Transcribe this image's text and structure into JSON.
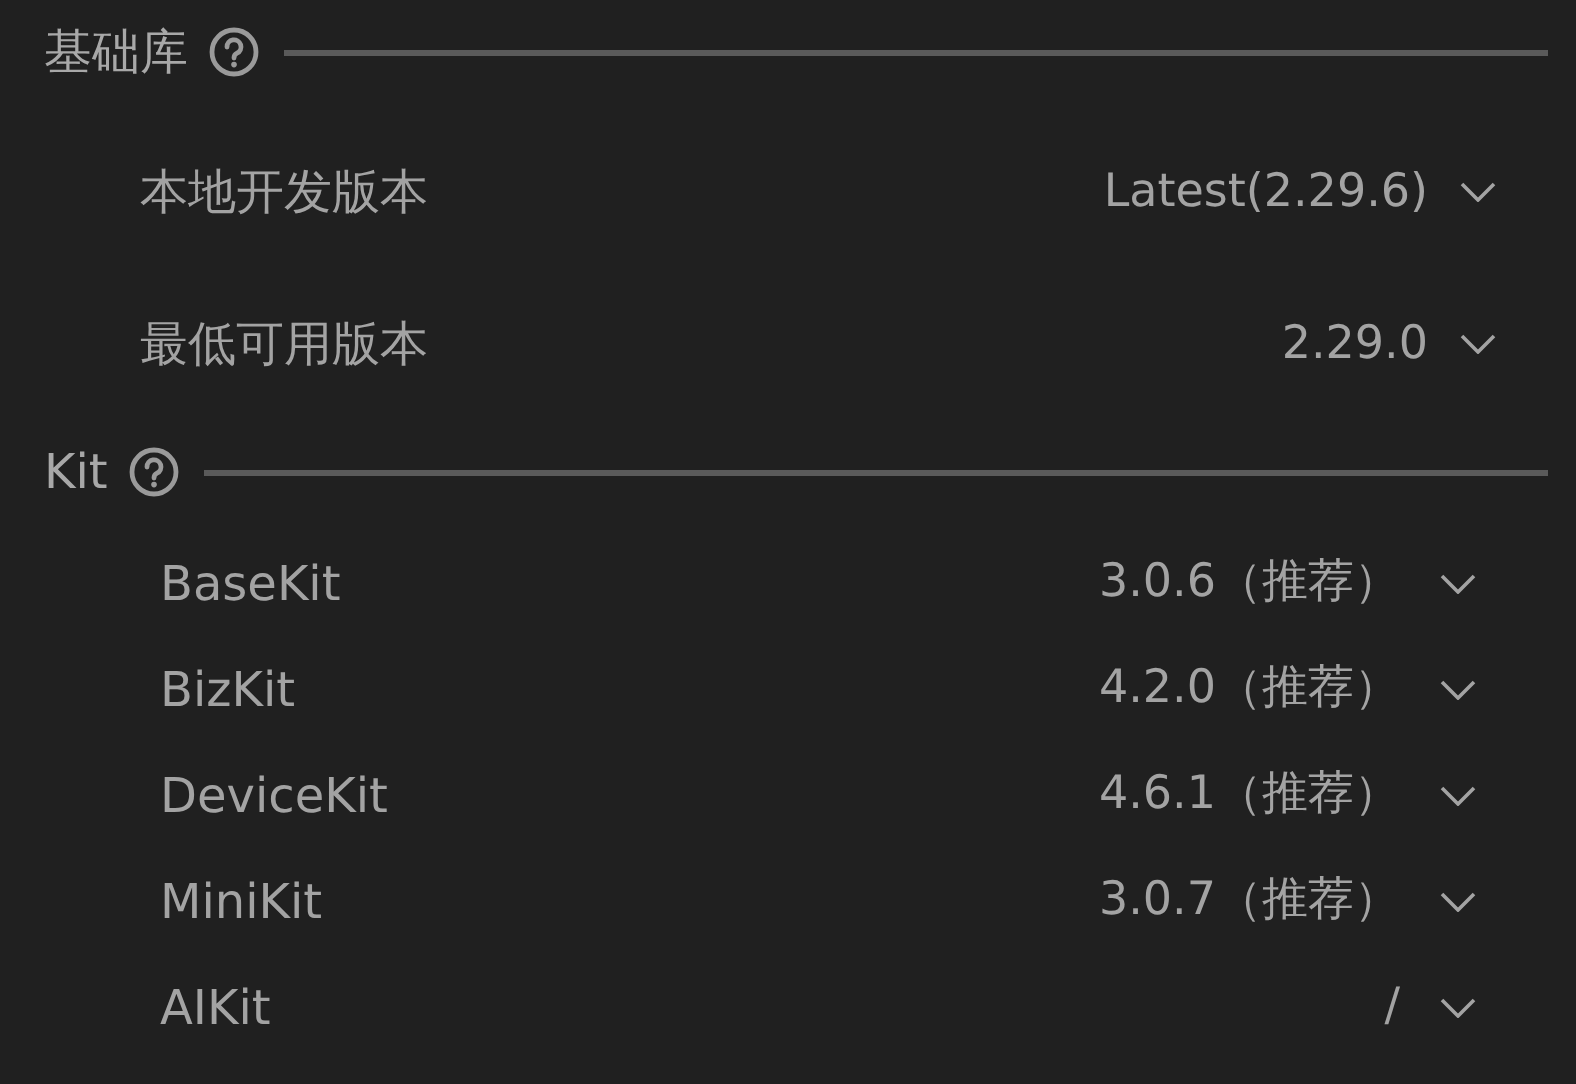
{
  "sections": [
    {
      "title": "基础库",
      "kind": "base",
      "rows": [
        {
          "label": "本地开发版本",
          "value": "Latest(2.29.6)"
        },
        {
          "label": "最低可用版本",
          "value": "2.29.0"
        }
      ]
    },
    {
      "title": "Kit",
      "kind": "kit",
      "rows": [
        {
          "label": "BaseKit",
          "value": "3.0.6（推荐）"
        },
        {
          "label": "BizKit",
          "value": "4.2.0（推荐）"
        },
        {
          "label": "DeviceKit",
          "value": "4.6.1（推荐）"
        },
        {
          "label": "MiniKit",
          "value": "3.0.7（推荐）"
        },
        {
          "label": "AIKit",
          "value": "/"
        }
      ]
    }
  ]
}
